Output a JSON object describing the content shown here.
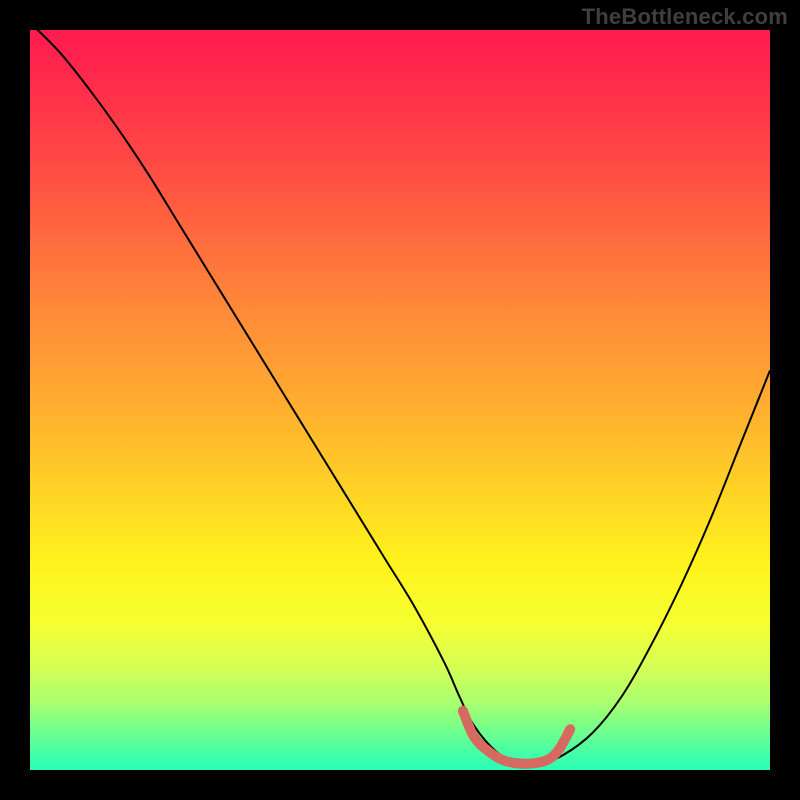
{
  "watermark": "TheBottleneck.com",
  "chart_data": {
    "type": "line",
    "title": "",
    "xlabel": "",
    "ylabel": "",
    "xlim": [
      0,
      100
    ],
    "ylim": [
      0,
      100
    ],
    "grid": false,
    "background_gradient": {
      "top": "#ff1a50",
      "mid": "#ffd226",
      "bottom": "#28ffb8"
    },
    "series": [
      {
        "name": "bottleneck-curve",
        "color": "#000000",
        "stroke_width": 2,
        "x": [
          0,
          4,
          8,
          12,
          16,
          20,
          24,
          28,
          32,
          36,
          40,
          44,
          48,
          52,
          56,
          58,
          60,
          63,
          66,
          69,
          72,
          76,
          80,
          84,
          88,
          92,
          96,
          100
        ],
        "y": [
          101,
          97,
          92,
          86.5,
          80.5,
          74,
          67.5,
          61,
          54.5,
          48,
          41.5,
          35,
          28.5,
          22,
          14.5,
          10,
          6,
          2.5,
          1,
          1,
          2,
          5,
          10,
          17,
          25,
          34,
          44,
          54
        ]
      },
      {
        "name": "highlight-optimal",
        "color": "#d66a60",
        "stroke_width": 10,
        "linecap": "round",
        "x": [
          58.5,
          60,
          62,
          64,
          66,
          68,
          70,
          71.5,
          73
        ],
        "y": [
          8,
          4.5,
          2.5,
          1.3,
          0.9,
          0.9,
          1.4,
          2.8,
          5.5
        ]
      }
    ],
    "annotations": []
  }
}
